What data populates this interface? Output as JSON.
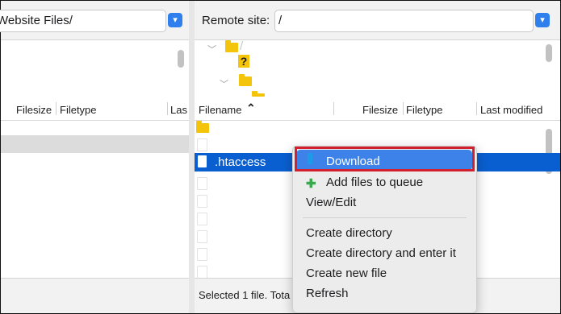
{
  "local": {
    "path_value": "Website Files/",
    "headers": {
      "filesize": "Filesize",
      "filetype": "Filetype",
      "lastmod": "Las"
    }
  },
  "remote": {
    "site_label": "Remote site:",
    "path_value": "/",
    "tree": {
      "unknown_mark": "?"
    },
    "headers": {
      "filename": "Filename",
      "sort_indicator": "⌃",
      "filesize": "Filesize",
      "filetype": "Filetype",
      "lastmod": "Last modified"
    },
    "selected_file": ".htaccess",
    "status_text": "Selected 1 file. Tota"
  },
  "context_menu": {
    "items": [
      {
        "label": "Download",
        "icon": "download-arrow-icon",
        "highlighted": true
      },
      {
        "label": "Add files to queue",
        "icon": "add-to-queue-icon"
      },
      {
        "label": "View/Edit"
      },
      {
        "label": "Create directory"
      },
      {
        "label": "Create directory and enter it"
      },
      {
        "label": "Create new file"
      },
      {
        "label": "Refresh"
      }
    ]
  },
  "colors": {
    "selection": "#0a5fd0",
    "menu_highlight": "#3c82e8",
    "callout_border": "#d2202f",
    "folder": "#f4c40b"
  }
}
